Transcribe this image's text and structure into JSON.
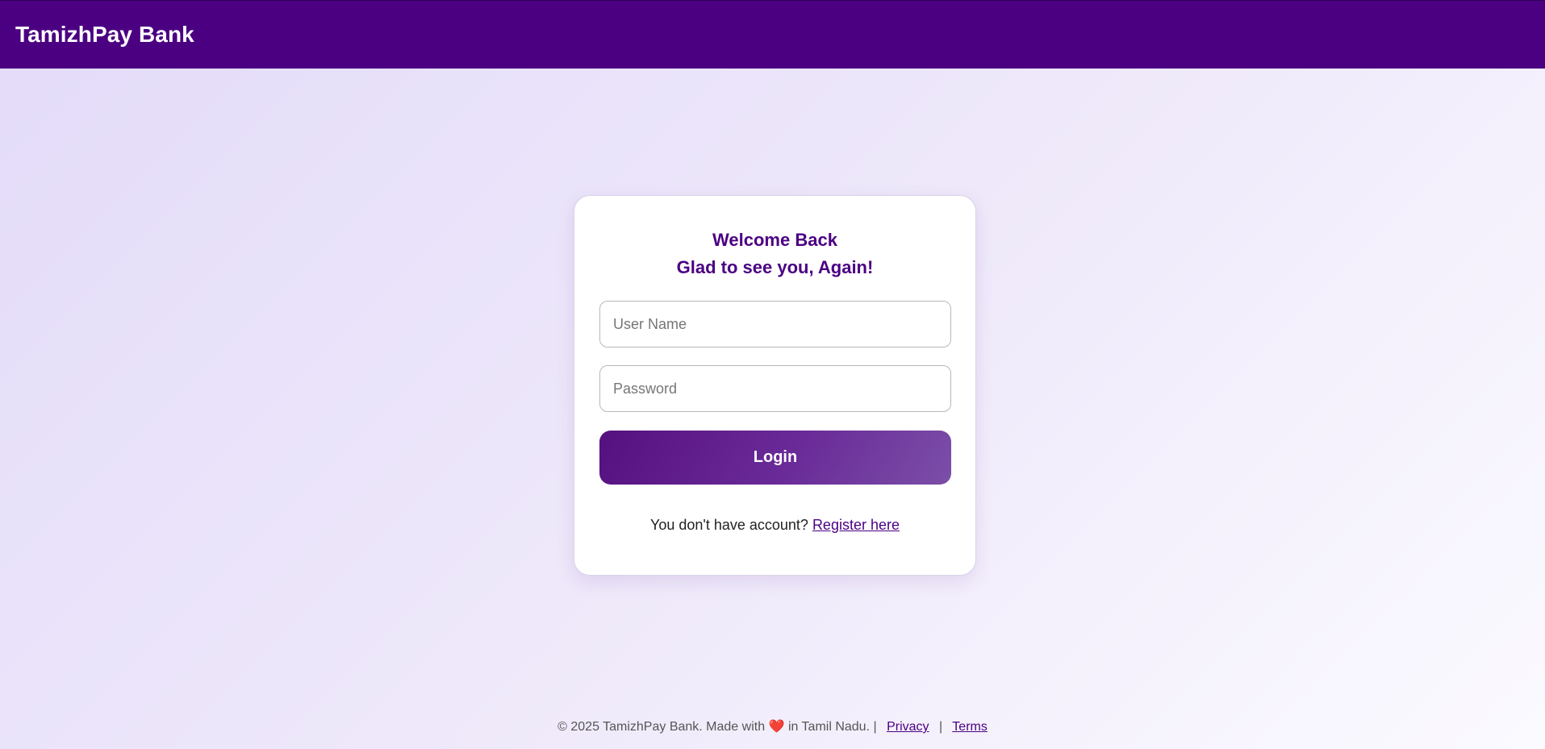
{
  "navbar": {
    "brand": "TamizhPay Bank"
  },
  "login_card": {
    "welcome_line1": "Welcome Back",
    "welcome_line2": "Glad to see you, Again!",
    "username_placeholder": "User Name",
    "password_placeholder": "Password",
    "login_label": "Login",
    "register_prompt": "You don't have account?",
    "register_link": "Register here"
  },
  "footer": {
    "copyright_prefix": "© 2025 TamizhPay Bank. Made with",
    "copyright_suffix": "in Tamil Nadu. |",
    "privacy_label": "Privacy",
    "separator": "|",
    "terms_label": "Terms",
    "heart_icon": "heart-icon"
  },
  "colors": {
    "brand_purple": "#4b0082",
    "heart_red": "#e8303b"
  }
}
